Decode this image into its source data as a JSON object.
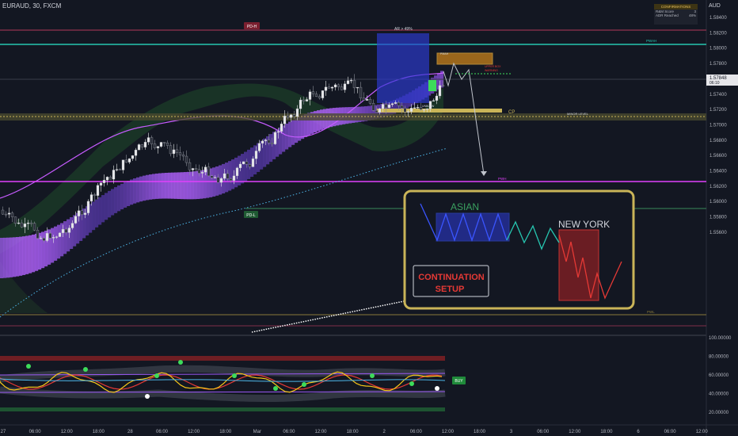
{
  "header": {
    "symbol": "EURAUD, 30, FXCM",
    "currency": "AUD"
  },
  "confirmations": {
    "title": "CONFIRMATIONS",
    "rows": [
      {
        "label": "R&M Score",
        "value": "3"
      },
      {
        "label": "ADR Reached",
        "value": "48%"
      }
    ]
  },
  "price_axis": {
    "ticks": [
      "1.58400",
      "1.58200",
      "1.58000",
      "1.57800",
      "1.57600",
      "1.57400",
      "1.57200",
      "1.57000",
      "1.56800",
      "1.56600",
      "1.56400",
      "1.56200",
      "1.56000",
      "1.55800",
      "1.55600"
    ],
    "current_price": "1.57848",
    "current_countdown": "06:10"
  },
  "indicator_axis": {
    "ticks": [
      "100.00000",
      "80.00000",
      "60.00000",
      "40.00000",
      "20.00000"
    ]
  },
  "time_axis": {
    "ticks": [
      "27",
      "06:00",
      "12:00",
      "18:00",
      "28",
      "06:00",
      "12:00",
      "18:00",
      "Mar",
      "06:00",
      "12:00",
      "18:00",
      "2",
      "06:00",
      "12:00",
      "18:00",
      "3",
      "06:00",
      "12:00",
      "18:00",
      "6",
      "06:00",
      "12:00"
    ]
  },
  "levels": {
    "pd_h": "PD-H",
    "pd_l": "PD-L",
    "pwah": "PWAH",
    "pwh": "PWH",
    "pwl": "PWL",
    "cp": "CP",
    "minor_level": "MINOR LEVEL",
    "adr": "AR > 49%",
    "unblow": "UNBLOW",
    "pmah": "PMAH",
    "upper_box_1": "UPPER BOX",
    "upper_box_2": "WARNING"
  },
  "panel": {
    "asian": "ASIAN",
    "new_york": "NEW YORK",
    "continuation_line1": "CONTINUATION",
    "continuation_line2": "SETUP"
  },
  "buy_label": "BUY",
  "colors": {
    "background": "#131722",
    "bull": "#e7e8ea",
    "bear": "#2a2e39",
    "ribbon": "#9b59f5",
    "gold": "#c9b458",
    "magenta": "#e040fb",
    "teal": "#26c6b0",
    "red": "#e53935",
    "green": "#3ddc5a",
    "blue_box": "#2d3bd6"
  }
}
